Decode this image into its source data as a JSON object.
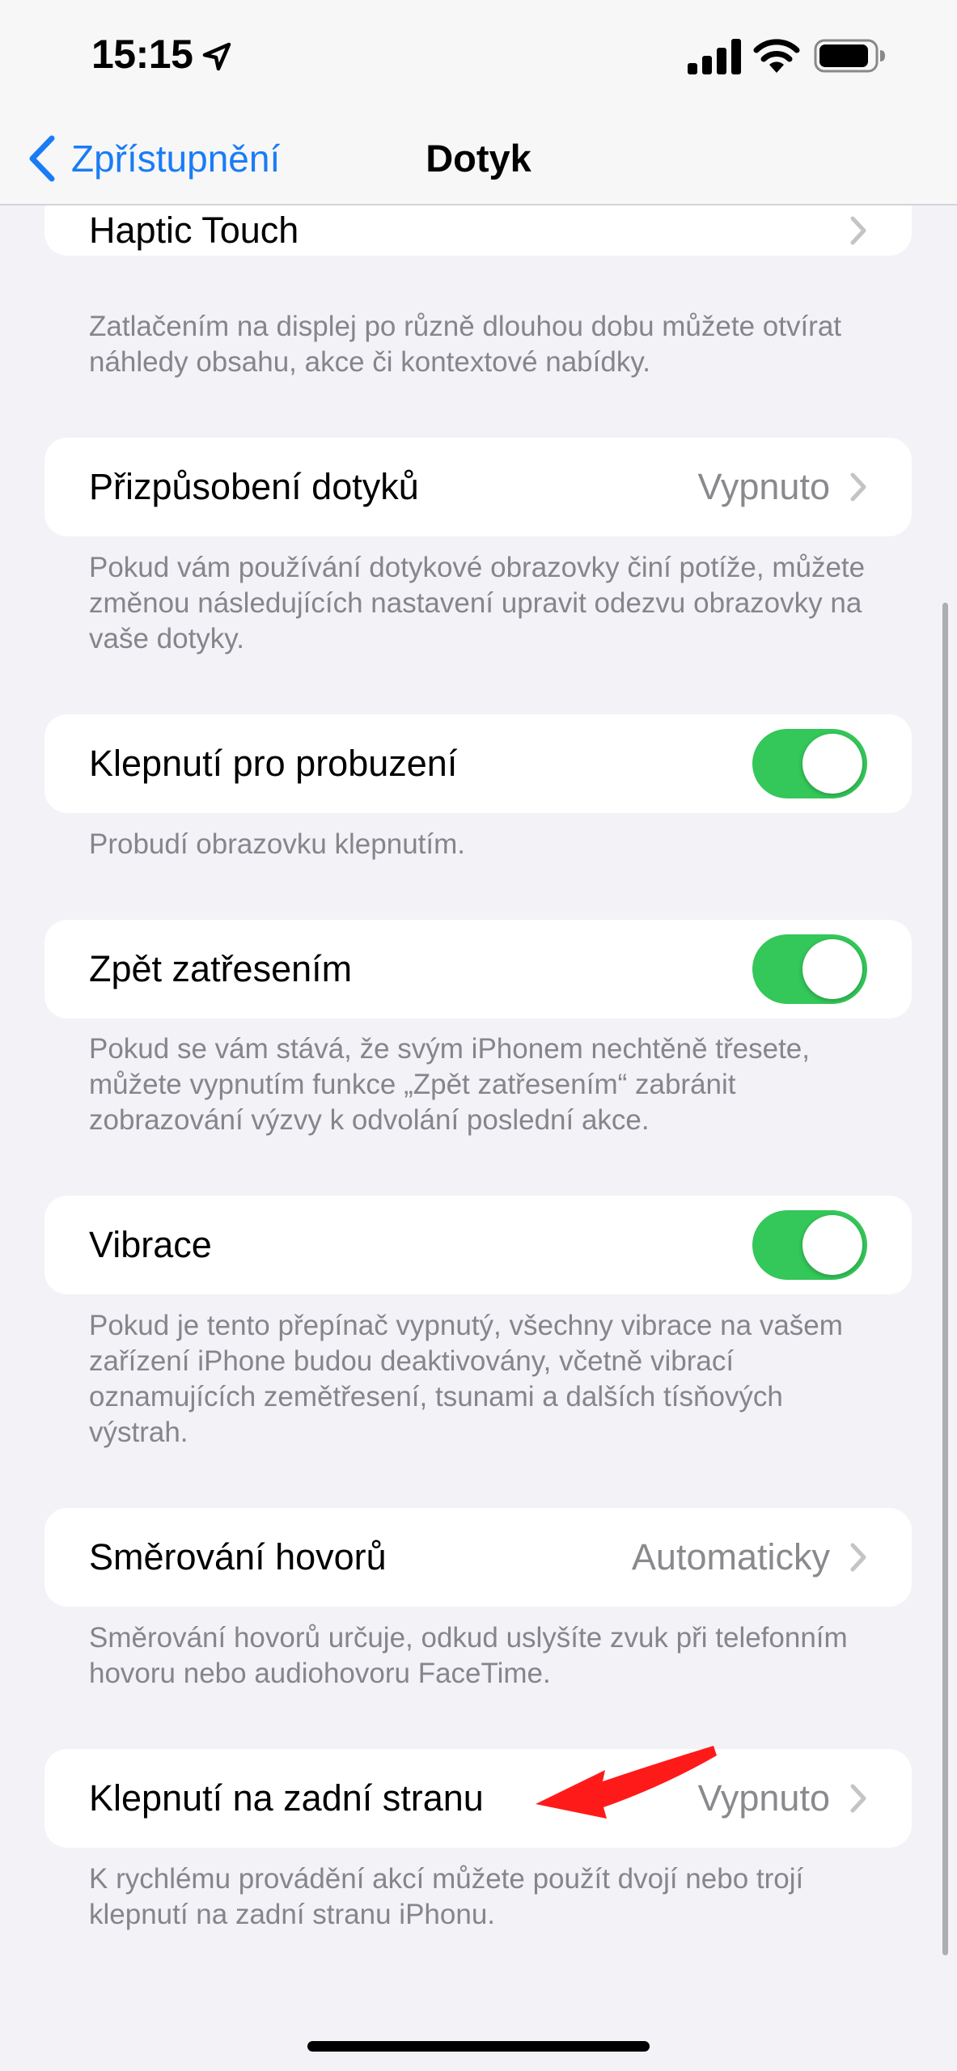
{
  "status_bar": {
    "time": "15:15",
    "icons": [
      "location-arrow-icon",
      "cellular-signal-icon",
      "wifi-icon",
      "battery-icon"
    ]
  },
  "nav": {
    "back_label": "Zpřístupnění",
    "title": "Dotyk",
    "accent_color": "#1a7cf5"
  },
  "sections": {
    "haptic": {
      "label": "Haptic Touch",
      "footer": "Zatlačením na displej po různě dlouhou dobu můžete otvírat náhledy obsahu, akce či kontextové nabídky."
    },
    "touch_accommodations": {
      "label": "Přizpůsobení dotyků",
      "value": "Vypnuto",
      "footer": "Pokud vám používání dotykové obrazovky činí potíže, můžete změnou následujících nastavení upravit odezvu obrazovky na vaše dotyky."
    },
    "tap_to_wake": {
      "label": "Klepnutí pro probuzení",
      "toggle_on": true,
      "footer": "Probudí obrazovku klepnutím."
    },
    "shake_to_undo": {
      "label": "Zpět zatřesením",
      "toggle_on": true,
      "footer": "Pokud se vám stává, že svým iPhonem nechtěně třesete, můžete vypnutím funkce „Zpět zatřesením“ zabránit zobrazování výzvy k odvolání poslední akce."
    },
    "vibration": {
      "label": "Vibrace",
      "toggle_on": true,
      "footer": "Pokud je tento přepínač vypnutý, všechny vibrace na vašem zařízení iPhone budou deaktivovány, včetně vibrací oznamujících zemětřesení, tsunami a dalších tísňových výstrah."
    },
    "call_audio_routing": {
      "label": "Směrování hovorů",
      "value": "Automaticky",
      "footer": "Směrování hovorů určuje, odkud uslyšíte zvuk při telefonním hovoru nebo audiohovoru FaceTime."
    },
    "back_tap": {
      "label": "Klepnutí na zadní stranu",
      "value": "Vypnuto",
      "footer": "K rychlému provádění akcí můžete použít dvojí nebo trojí klepnutí na zadní stranu iPhonu."
    }
  },
  "colors": {
    "toggle_on": "#34c759",
    "annotation_arrow": "#ff1a1a"
  }
}
